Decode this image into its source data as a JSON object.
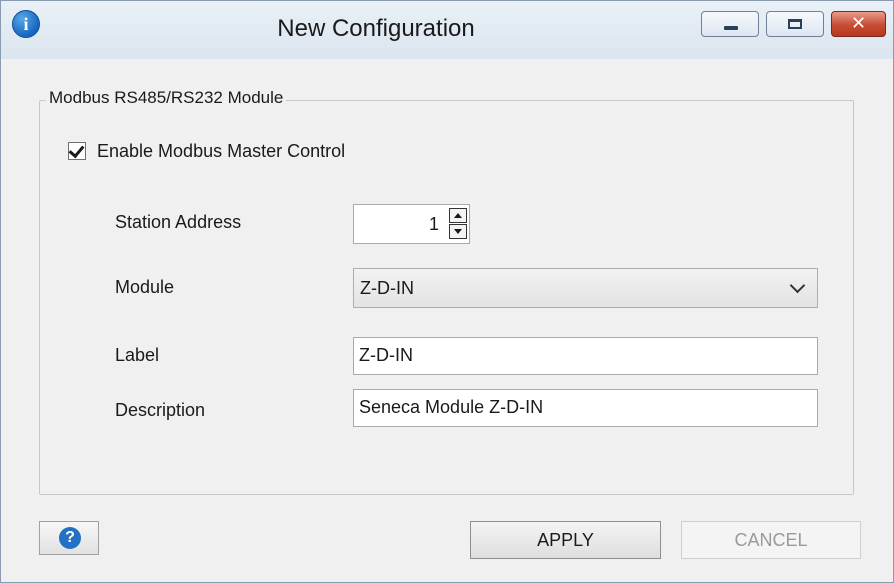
{
  "window": {
    "title": "New Configuration",
    "icon": "info-icon",
    "icon_glyph": "i",
    "close_glyph": "✕"
  },
  "group": {
    "legend": "Modbus RS485/RS232 Module",
    "enable_label": "Enable Modbus Master Control",
    "enable_checked": true
  },
  "fields": {
    "station_label": "Station Address",
    "station_value": "1",
    "module_label": "Module",
    "module_value": "Z-D-IN",
    "label_label": "Label",
    "label_value": "Z-D-IN",
    "description_label": "Description",
    "description_value": "Seneca Module Z-D-IN"
  },
  "footer": {
    "help_glyph": "?",
    "apply_label": "APPLY",
    "cancel_label": "CANCEL"
  },
  "colors": {
    "accent": "#2370c4",
    "close": "#c64c33"
  }
}
